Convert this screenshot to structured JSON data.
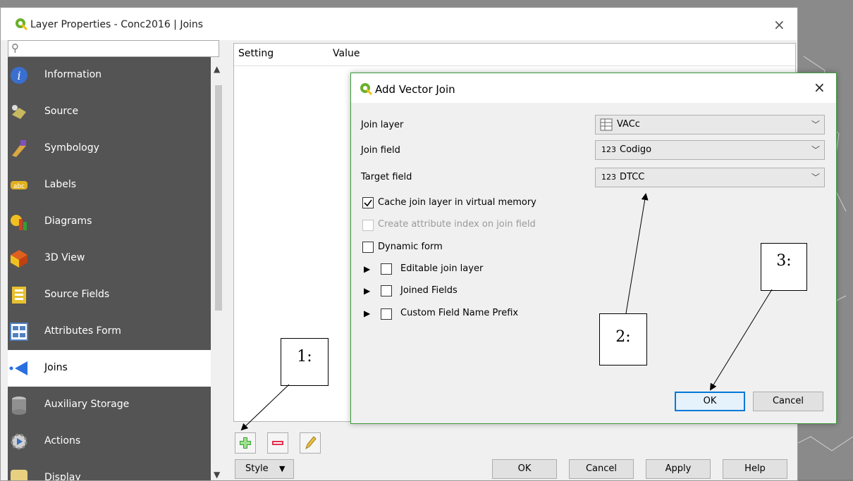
{
  "window": {
    "title": "Layer Properties - Conc2016 | Joins",
    "close": "×"
  },
  "search": {
    "placeholder": ""
  },
  "sidebar": {
    "items": [
      {
        "label": "Information",
        "icon": "information-icon",
        "color": "#3a6fd0"
      },
      {
        "label": "Source",
        "icon": "source-icon",
        "color": "#c8b860"
      },
      {
        "label": "Symbology",
        "icon": "symbology-icon",
        "color": "#d9a840"
      },
      {
        "label": "Labels",
        "icon": "labels-icon",
        "color": "#e0b020"
      },
      {
        "label": "Diagrams",
        "icon": "diagrams-icon",
        "color": "#d04020"
      },
      {
        "label": "3D View",
        "icon": "3d-view-icon",
        "color": "#e06020"
      },
      {
        "label": "Source Fields",
        "icon": "source-fields-icon",
        "color": "#e8c030"
      },
      {
        "label": "Attributes Form",
        "icon": "attributes-form-icon",
        "color": "#5080c0"
      },
      {
        "label": "Joins",
        "icon": "joins-icon",
        "color": "#2a6fe0"
      },
      {
        "label": "Auxiliary Storage",
        "icon": "auxiliary-storage-icon",
        "color": "#909090"
      },
      {
        "label": "Actions",
        "icon": "actions-icon",
        "color": "#3a70c0"
      },
      {
        "label": "Display",
        "icon": "display-icon",
        "color": "#e8d080"
      }
    ],
    "active_index": 8
  },
  "table": {
    "col_setting": "Setting",
    "col_value": "Value"
  },
  "toolbar": {
    "add": "+",
    "remove": "−",
    "edit": "✎"
  },
  "footer": {
    "style_label": "Style",
    "ok": "OK",
    "cancel": "Cancel",
    "apply": "Apply",
    "help": "Help"
  },
  "dialog": {
    "title": "Add Vector Join",
    "close": "×",
    "join_layer_label": "Join layer",
    "join_layer_value": "VACc",
    "join_field_label": "Join field",
    "join_field_prefix": "123",
    "join_field_value": "Codigo",
    "target_field_label": "Target field",
    "target_field_prefix": "123",
    "target_field_value": "DTCC",
    "cache_label": "Cache join layer in virtual memory",
    "cache_checked": true,
    "index_label": "Create attribute index on join field",
    "dynamic_label": "Dynamic form",
    "editable_label": "Editable join layer",
    "joined_fields_label": "Joined Fields",
    "prefix_label": "Custom Field Name Prefix",
    "ok": "OK",
    "cancel": "Cancel"
  },
  "annotations": {
    "a1": "1:",
    "a2": "2:",
    "a3": "3:"
  },
  "colors": {
    "qgis_green": "#6ab02a",
    "dialog_border": "#3c9a3c",
    "ok_focus": "#0078d7"
  }
}
